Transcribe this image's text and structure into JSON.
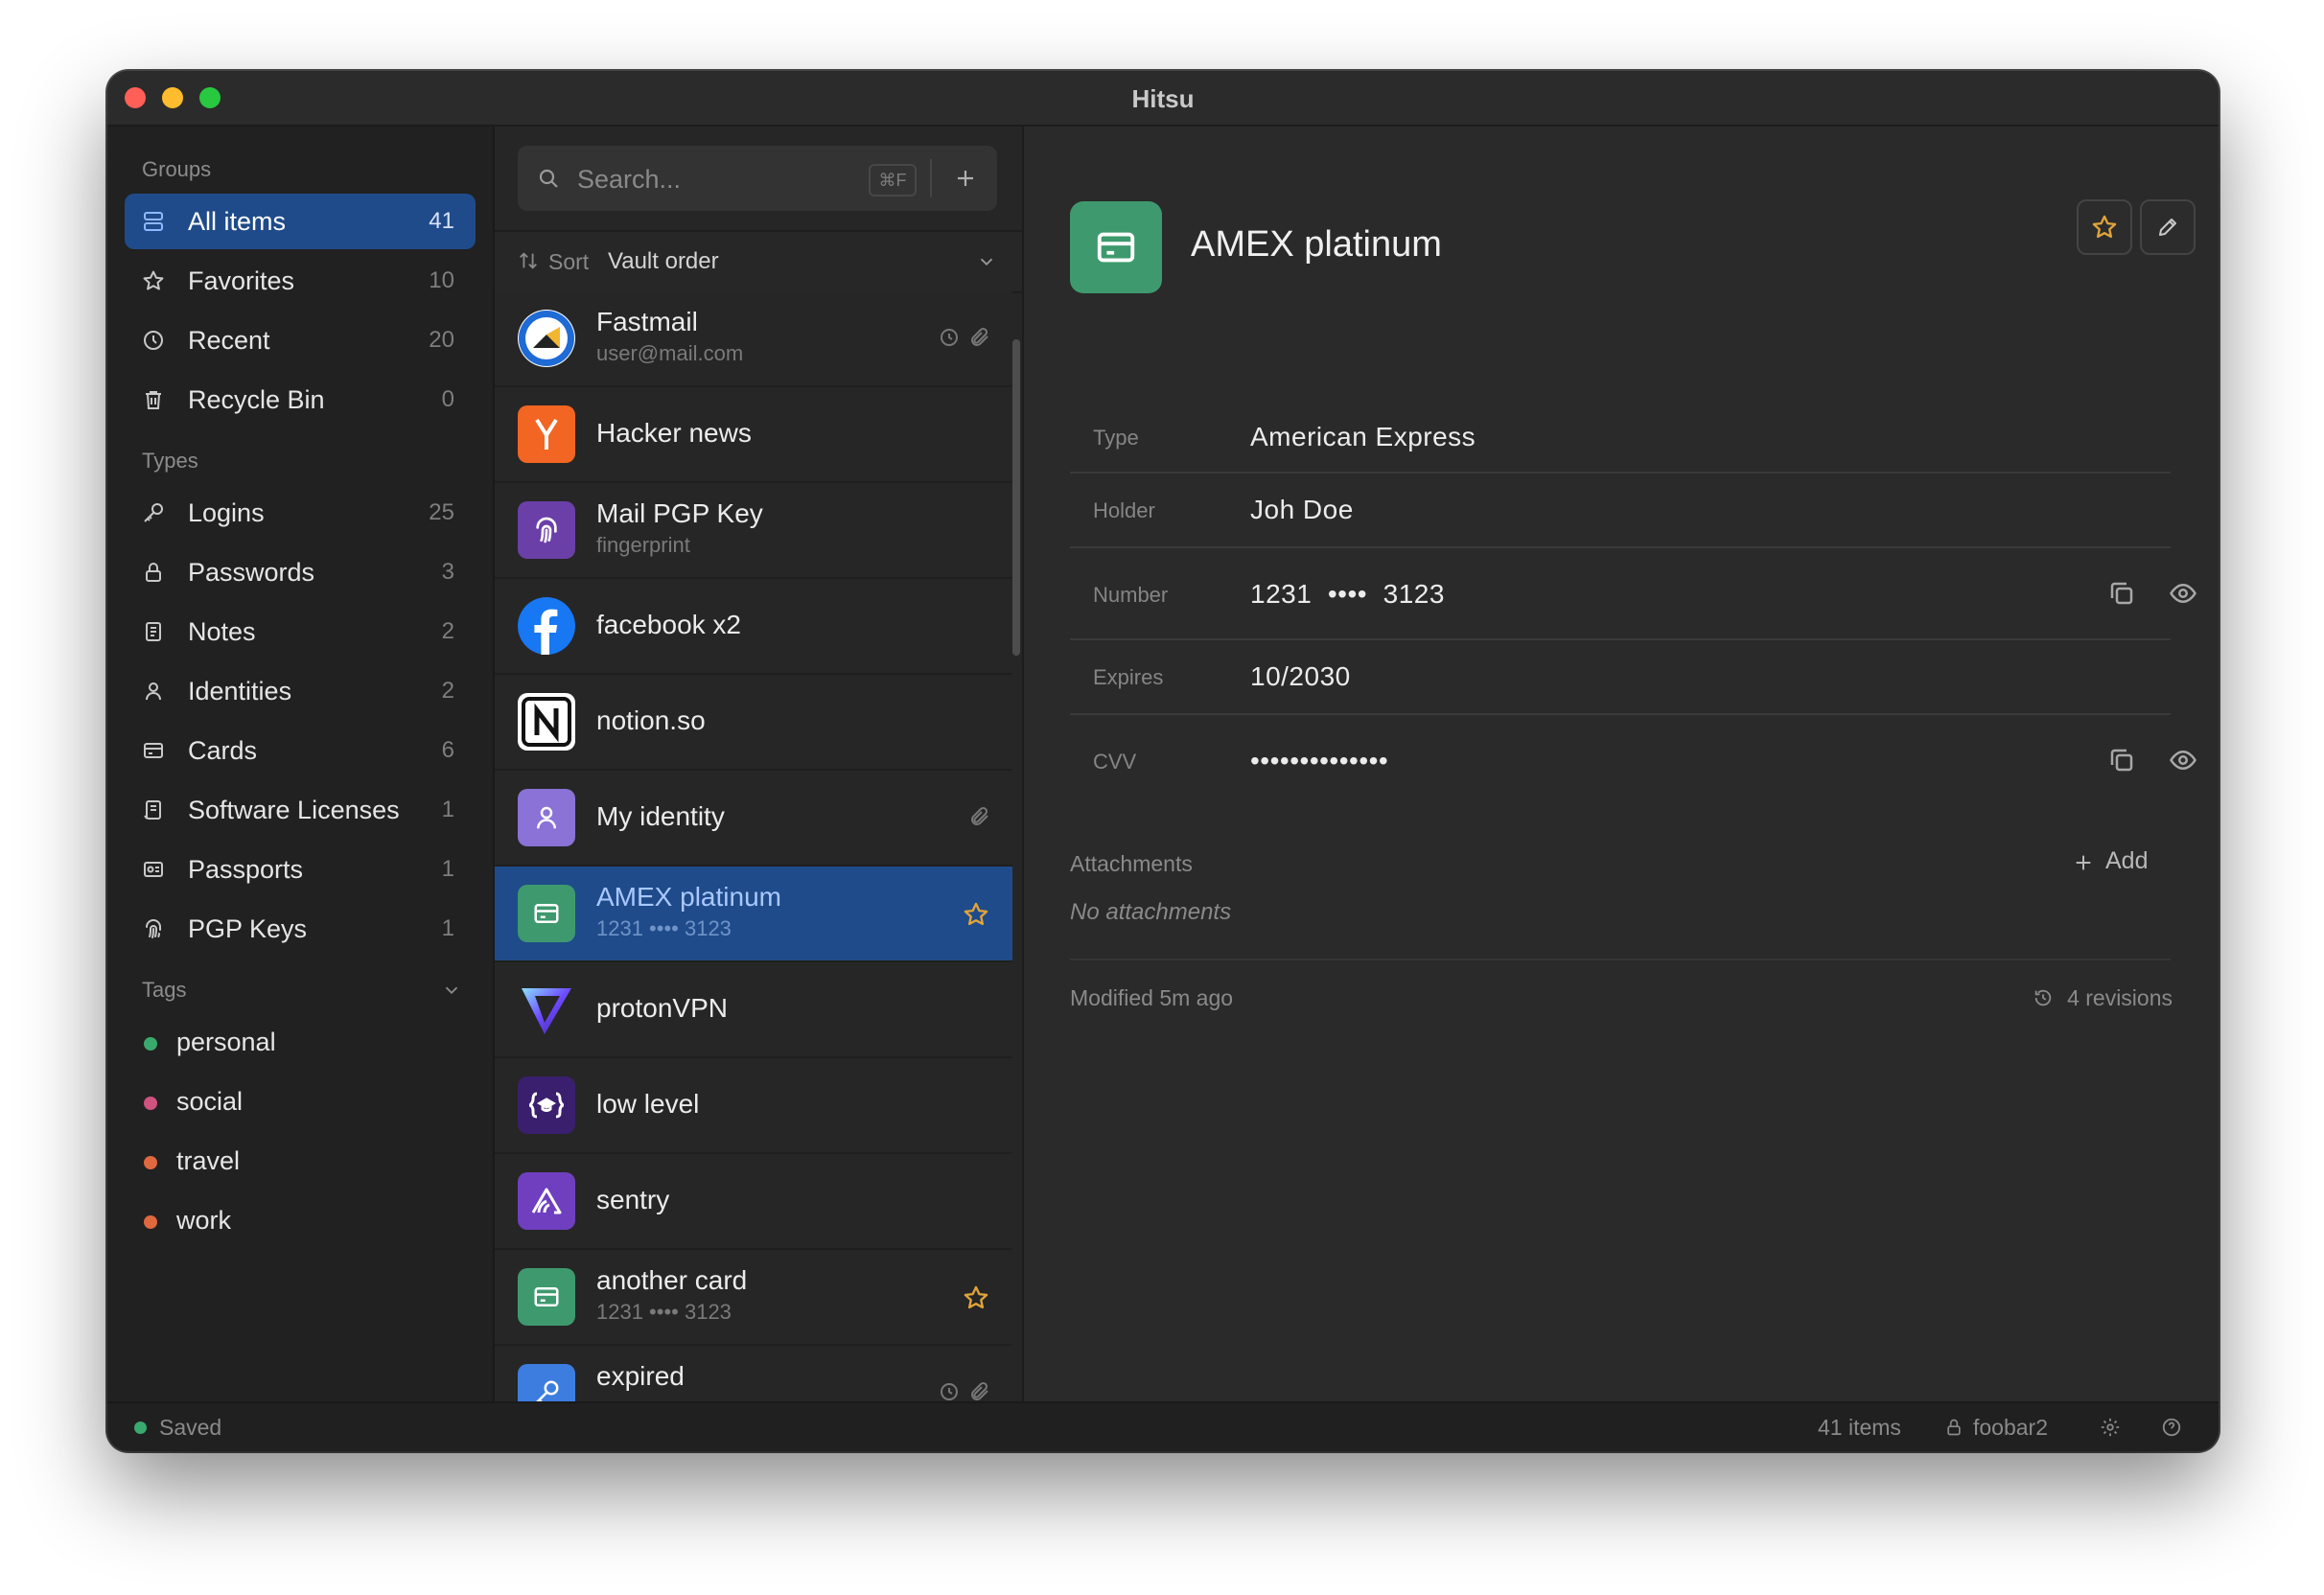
{
  "window": {
    "title": "Hitsu"
  },
  "sidebar": {
    "groups_label": "Groups",
    "groups": [
      {
        "label": "All items",
        "count": "41",
        "icon": "stack-icon",
        "active": true
      },
      {
        "label": "Favorites",
        "count": "10",
        "icon": "star-icon"
      },
      {
        "label": "Recent",
        "count": "20",
        "icon": "clock-icon"
      },
      {
        "label": "Recycle Bin",
        "count": "0",
        "icon": "trash-icon"
      }
    ],
    "types_label": "Types",
    "types": [
      {
        "label": "Logins",
        "count": "25",
        "icon": "key-icon"
      },
      {
        "label": "Passwords",
        "count": "3",
        "icon": "lock-icon"
      },
      {
        "label": "Notes",
        "count": "2",
        "icon": "note-icon"
      },
      {
        "label": "Identities",
        "count": "2",
        "icon": "person-icon"
      },
      {
        "label": "Cards",
        "count": "6",
        "icon": "card-icon"
      },
      {
        "label": "Software Licenses",
        "count": "1",
        "icon": "license-icon"
      },
      {
        "label": "Passports",
        "count": "1",
        "icon": "passport-icon"
      },
      {
        "label": "PGP Keys",
        "count": "1",
        "icon": "fingerprint-icon"
      }
    ],
    "tags_label": "Tags",
    "tags": [
      {
        "label": "personal",
        "color": "#3aa96d"
      },
      {
        "label": "social",
        "color": "#d0527e"
      },
      {
        "label": "travel",
        "color": "#e0683e"
      },
      {
        "label": "work",
        "color": "#e0683e"
      }
    ]
  },
  "list": {
    "search_placeholder": "Search...",
    "search_shortcut": "⌘F",
    "sort_label": "Sort",
    "sort_value": "Vault order",
    "items": [
      {
        "title": "Fastmail",
        "subtitle": "user@mail.com",
        "icon": "fastmail-icon",
        "badges": [
          "history-icon",
          "paperclip-icon"
        ]
      },
      {
        "title": "Hacker news",
        "subtitle": "",
        "icon": "hacker-news-icon"
      },
      {
        "title": "Mail PGP Key",
        "subtitle": "fingerprint",
        "icon": "fingerprint-icon"
      },
      {
        "title": "facebook x2",
        "subtitle": "",
        "icon": "facebook-icon"
      },
      {
        "title": "notion.so",
        "subtitle": "",
        "icon": "notion-icon"
      },
      {
        "title": "My identity",
        "subtitle": "",
        "icon": "identity-icon",
        "badges": [
          "paperclip-icon"
        ]
      },
      {
        "title": "AMEX platinum",
        "subtitle": "1231 •••• 3123",
        "icon": "card-icon",
        "selected": true,
        "star": true
      },
      {
        "title": "protonVPN",
        "subtitle": "",
        "icon": "protonvpn-icon"
      },
      {
        "title": "low level",
        "subtitle": "",
        "icon": "lowlevel-icon"
      },
      {
        "title": "sentry",
        "subtitle": "",
        "icon": "sentry-icon"
      },
      {
        "title": "another card",
        "subtitle": "1231 •••• 3123",
        "icon": "card-icon",
        "star": true
      },
      {
        "title": "expired",
        "subtitle": "",
        "icon": "key-icon",
        "badges": [
          "history-icon",
          "paperclip-icon"
        ]
      }
    ]
  },
  "detail": {
    "title": "AMEX platinum",
    "icon": "card-icon",
    "fields": [
      {
        "label": "Type",
        "value": "American Express"
      },
      {
        "label": "Holder",
        "value": "Joh Doe"
      },
      {
        "label": "Number",
        "value": "1231  ••••  3123"
      },
      {
        "label": "Expires",
        "value": "10/2030"
      },
      {
        "label": "CVV",
        "value": "••••••••••••••"
      }
    ],
    "attachments_label": "Attachments",
    "add_label": "Add",
    "no_attachments": "No attachments",
    "modified": "Modified 5m ago",
    "revisions": "4 revisions"
  },
  "status": {
    "saved": "Saved",
    "items_count": "41 items",
    "vault": "foobar2"
  },
  "colors": {
    "accent": "#1f4b8a",
    "card_green": "#3e9a6e",
    "star": "#e0a43a"
  }
}
